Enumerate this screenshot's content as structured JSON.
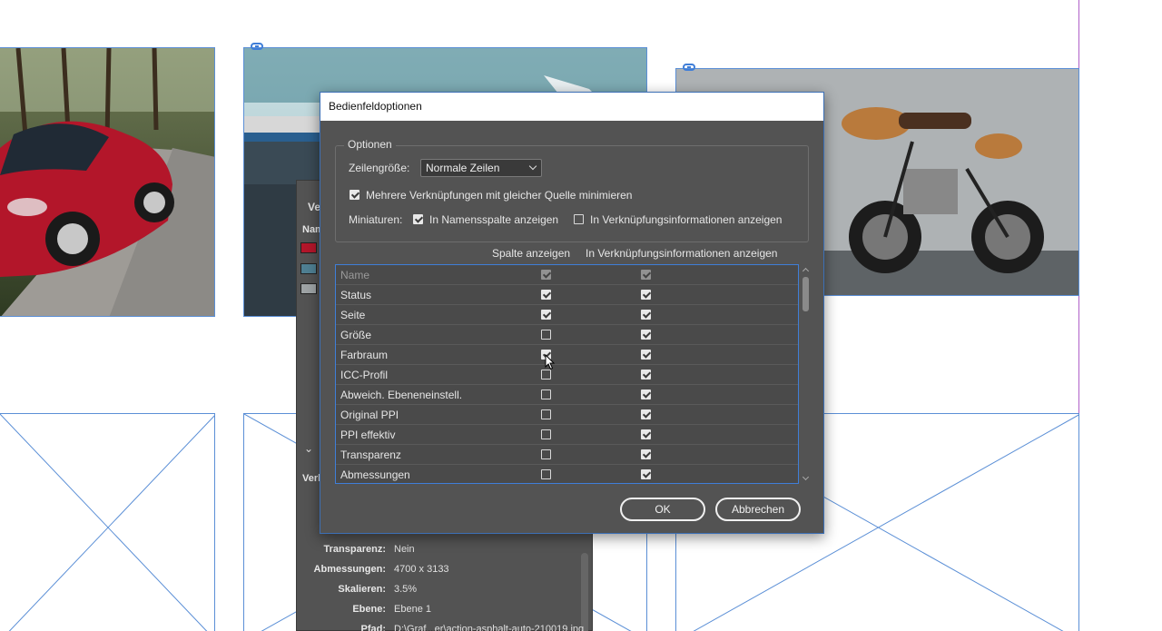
{
  "dialog": {
    "title": "Bedienfeldoptionen",
    "options_legend": "Optionen",
    "row_size_label": "Zeilengröße:",
    "row_size_value": "Normale Zeilen",
    "minimize_links_label": "Mehrere Verknüpfungen mit gleicher Quelle minimieren",
    "minimize_links_checked": true,
    "thumbnails_label": "Miniaturen:",
    "thumb_name_col_label": "In Namensspalte anzeigen",
    "thumb_name_col_checked": true,
    "thumb_info_label": "In Verknüpfungsinformationen anzeigen",
    "thumb_info_checked": false,
    "col_header_show": "Spalte anzeigen",
    "col_header_info": "In Verknüpfungsinformationen anzeigen",
    "rows": [
      {
        "name": "Name",
        "show": true,
        "info": true,
        "disabled": true
      },
      {
        "name": "Status",
        "show": true,
        "info": true
      },
      {
        "name": "Seite",
        "show": true,
        "info": true
      },
      {
        "name": "Größe",
        "show": false,
        "info": true
      },
      {
        "name": "Farbraum",
        "show": true,
        "info": true
      },
      {
        "name": "ICC-Profil",
        "show": false,
        "info": true
      },
      {
        "name": "Abweich. Ebeneneinstell.",
        "show": false,
        "info": true
      },
      {
        "name": "Original PPI",
        "show": false,
        "info": true
      },
      {
        "name": "PPI effektiv",
        "show": false,
        "info": true
      },
      {
        "name": "Transparenz",
        "show": false,
        "info": true
      },
      {
        "name": "Abmessungen",
        "show": false,
        "info": true
      }
    ],
    "ok_label": "OK",
    "cancel_label": "Abbrechen"
  },
  "links_panel": {
    "tab_label": "Ve",
    "name_col": "Nam",
    "collapsed_label": "Verk",
    "info": [
      {
        "key": "Transparenz:",
        "value": "Nein"
      },
      {
        "key": "Abmessungen:",
        "value": "4700 x 3133"
      },
      {
        "key": "Skalieren:",
        "value": "3.5%"
      },
      {
        "key": "Ebene:",
        "value": "Ebene 1"
      },
      {
        "key": "Pfad:",
        "value": "D:\\Graf...er\\action-asphalt-auto-210019.jpg"
      }
    ]
  },
  "colors": {
    "panel_bg": "#535353",
    "frame_border": "#5b8fd6",
    "selection_blue": "#3f7ed8",
    "guide_purple": "#b060c8"
  }
}
